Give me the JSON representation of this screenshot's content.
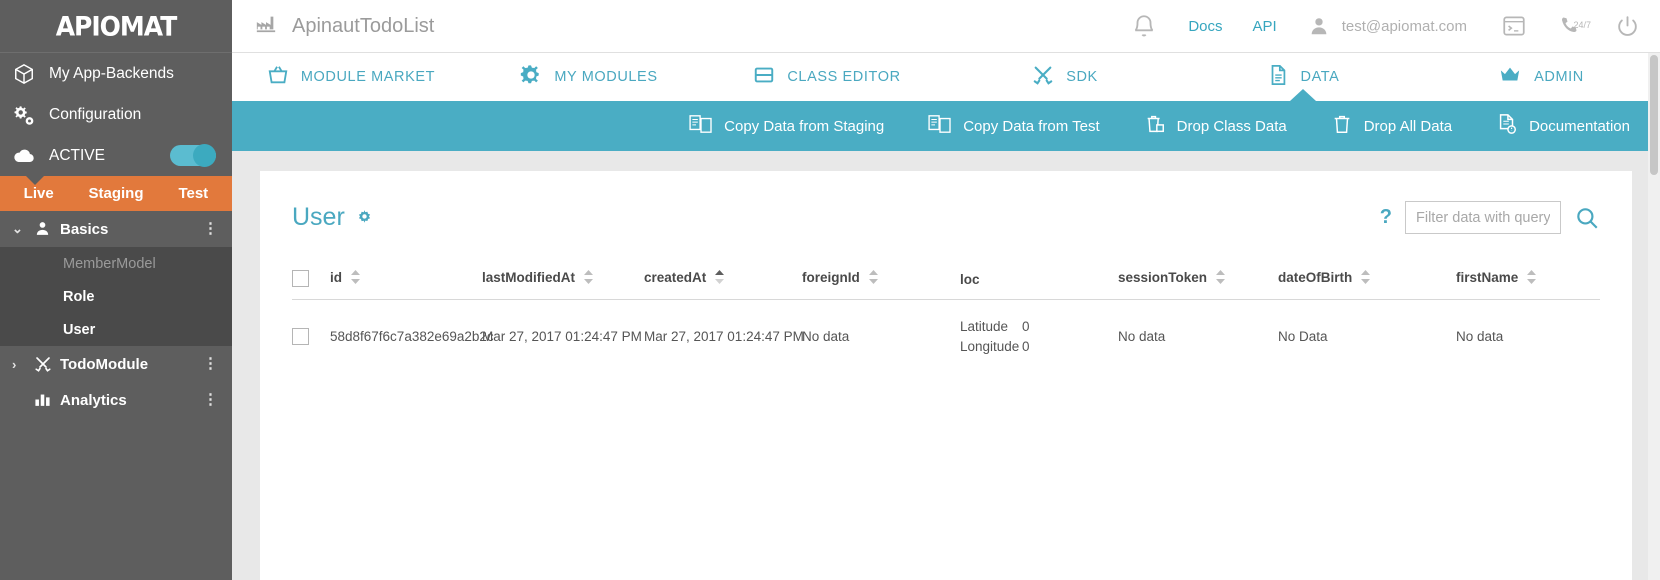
{
  "brand": {
    "logo_text": "APIOMAT",
    "accent": "#4aadc4",
    "orange": "#e2793c",
    "sidebar_bg": "#5e5e5e"
  },
  "sidebar": {
    "nav": [
      {
        "label": "My App-Backends",
        "icon": "cube-icon"
      },
      {
        "label": "Configuration",
        "icon": "gears-icon"
      },
      {
        "label": "ACTIVE",
        "icon": "cloud-icon",
        "toggle": true
      }
    ],
    "environments": [
      {
        "label": "Live",
        "selected": true
      },
      {
        "label": "Staging",
        "selected": false
      },
      {
        "label": "Test",
        "selected": false
      }
    ],
    "tree": [
      {
        "label": "Basics",
        "icon": "user-icon",
        "expanded": true,
        "chevron": "⌄",
        "children": [
          {
            "label": "MemberModel",
            "dim": true
          },
          {
            "label": "Role",
            "dim": false
          },
          {
            "label": "User",
            "dim": false,
            "selected": true
          }
        ]
      },
      {
        "label": "TodoModule",
        "icon": "tools-icon",
        "expanded": false,
        "chevron": "›",
        "children": []
      },
      {
        "label": "Analytics",
        "icon": "chart-icon",
        "chevron": "",
        "children": []
      }
    ]
  },
  "topbar": {
    "app_icon": "factory-icon",
    "app_title": "ApinautTodoList",
    "bell_icon": "bell-icon",
    "docs_label": "Docs",
    "api_label": "API",
    "user_icon": "user-avatar-icon",
    "user_email": "test@apiomat.com",
    "terminal_icon": "terminal-icon",
    "support_icon": "phone-24-7-icon",
    "support_badge": "24/7",
    "power_icon": "power-icon"
  },
  "navtabs": [
    {
      "label": "MODULE MARKET",
      "icon": "basket-icon",
      "active": false
    },
    {
      "label": "MY MODULES",
      "icon": "gear-icon",
      "active": false
    },
    {
      "label": "CLASS EDITOR",
      "icon": "table-icon",
      "active": false
    },
    {
      "label": "SDK",
      "icon": "tools-icon",
      "active": false
    },
    {
      "label": "DATA",
      "icon": "document-icon",
      "active": true
    },
    {
      "label": "ADMIN",
      "icon": "crown-icon",
      "active": false
    }
  ],
  "actionbar": [
    {
      "label": "Copy Data from Staging",
      "icon": "copy-docs-icon"
    },
    {
      "label": "Copy Data from Test",
      "icon": "copy-docs-icon"
    },
    {
      "label": "Drop Class Data",
      "icon": "trash-class-icon"
    },
    {
      "label": "Drop All Data",
      "icon": "trash-icon"
    },
    {
      "label": "Documentation",
      "icon": "doc-info-icon"
    }
  ],
  "card": {
    "title": "User",
    "gear_icon": "settings-gear-icon",
    "help_label": "?",
    "search": {
      "placeholder": "Filter data with query",
      "value": "",
      "icon": "search-icon"
    }
  },
  "table": {
    "columns": [
      {
        "key": "checkbox",
        "label": "",
        "sortable": false,
        "cls": "c-chk"
      },
      {
        "key": "id",
        "label": "id",
        "sortable": true,
        "active": false,
        "cls": "c-id"
      },
      {
        "key": "lastModifiedAt",
        "label": "lastModifiedAt",
        "sortable": true,
        "active": false,
        "cls": "c-lm"
      },
      {
        "key": "createdAt",
        "label": "createdAt",
        "sortable": true,
        "active": true,
        "cls": "c-ca"
      },
      {
        "key": "foreignId",
        "label": "foreignId",
        "sortable": true,
        "active": false,
        "cls": "c-fi"
      },
      {
        "key": "loc",
        "label": "loc",
        "sortable": false,
        "cls": "c-loc"
      },
      {
        "key": "sessionToken",
        "label": "sessionToken",
        "sortable": true,
        "active": false,
        "cls": "c-st"
      },
      {
        "key": "dateOfBirth",
        "label": "dateOfBirth",
        "sortable": true,
        "active": false,
        "cls": "c-dob"
      },
      {
        "key": "firstName",
        "label": "firstName",
        "sortable": true,
        "active": false,
        "cls": "c-fn"
      }
    ],
    "rows": [
      {
        "id": "58d8f67f6c7a382e69a2b2c",
        "lastModifiedAt": "Mar 27, 2017 01:24:47 PM",
        "createdAt": "Mar 27, 2017 01:24:47 PM",
        "foreignId": "No data",
        "loc": {
          "lat_label": "Latitude",
          "lat_value": "0",
          "lon_label": "Longitude",
          "lon_value": "0"
        },
        "sessionToken": "No data",
        "dateOfBirth": "No Data",
        "firstName": "No data"
      }
    ]
  }
}
